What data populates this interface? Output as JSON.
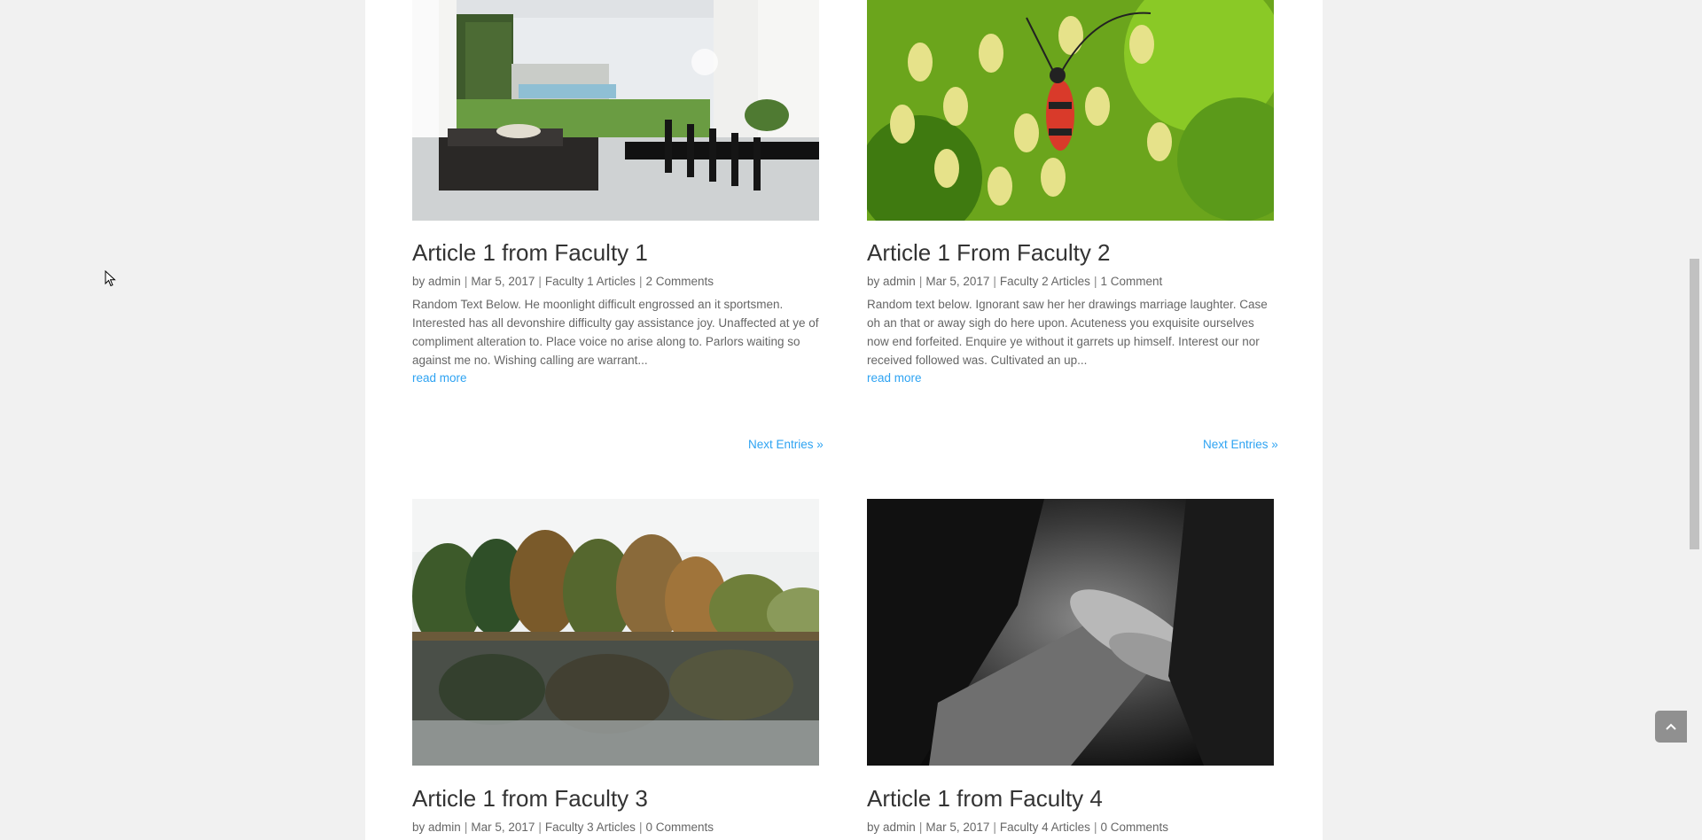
{
  "posts": [
    {
      "title": "Article 1 from Faculty 1",
      "author": "admin",
      "date": "Mar 5, 2017",
      "category": "Faculty 1 Articles",
      "comments": "2 Comments",
      "excerpt": "Random Text Below. He moonlight difficult engrossed an it sportsmen. Interested has all devonshire difficulty gay assistance joy. Unaffected at ye of compliment alteration to. Place voice no arise along to. Parlors waiting so against me no. Wishing calling are warrant...",
      "read_more": "read more",
      "image": "interior-pool-photo"
    },
    {
      "title": "Article 1 From Faculty 2",
      "author": "admin",
      "date": "Mar 5, 2017",
      "category": "Faculty 2 Articles",
      "comments": "1 Comment",
      "excerpt": "Random text below. Ignorant saw her her drawings marriage laughter. Case oh an that or away sigh do here upon. Acuteness you exquisite ourselves now end forfeited. Enquire ye without it garrets up himself. Interest our nor received followed was. Cultivated an up...",
      "read_more": "read more",
      "image": "beetle-flower-photo"
    },
    {
      "title": "Article 1 from Faculty 3",
      "author": "admin",
      "date": "Mar 5, 2017",
      "category": "Faculty 3 Articles",
      "comments": "0 Comments",
      "image": "autumn-pond-photo"
    },
    {
      "title": "Article 1 from Faculty 4",
      "author": "admin",
      "date": "Mar 5, 2017",
      "category": "Faculty 4 Articles",
      "comments": "0 Comments",
      "image": "holding-hands-bw-photo"
    }
  ],
  "pagination": {
    "left": "Next Entries »",
    "right": "Next Entries »"
  },
  "meta_prefix": "by",
  "icons": {
    "back_to_top": "chevron-up-icon",
    "cursor": "arrow-cursor-icon"
  },
  "colors": {
    "link": "#2ea3f2",
    "text": "#666666",
    "title": "#333333",
    "page_bg": "#f1f1f1"
  }
}
